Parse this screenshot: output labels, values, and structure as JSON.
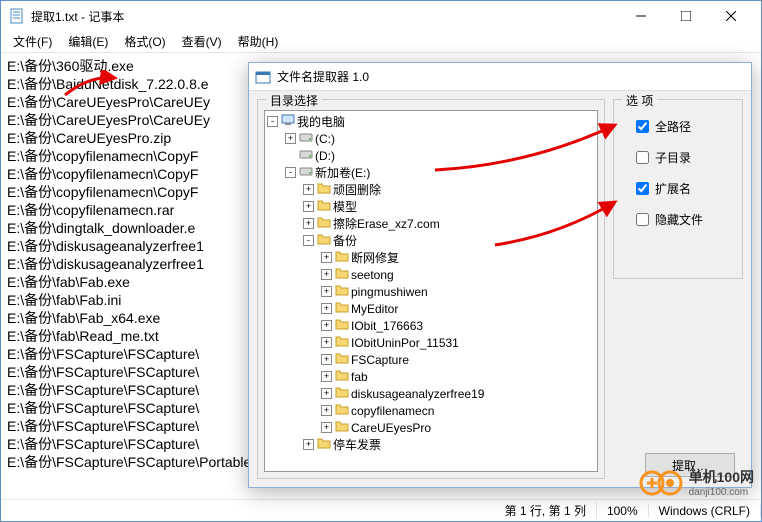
{
  "window": {
    "title": "提取1.txt - 记事本"
  },
  "menu": {
    "file": "文件(F)",
    "edit": "编辑(E)",
    "format": "格式(O)",
    "view": "查看(V)",
    "help": "帮助(H)"
  },
  "lines": [
    "E:\\备份\\360驱动.exe",
    "E:\\备份\\BaiduNetdisk_7.22.0.8.e",
    "E:\\备份\\CareUEyesPro\\CareUEy",
    "E:\\备份\\CareUEyesPro\\CareUEy",
    "E:\\备份\\CareUEyesPro.zip",
    "E:\\备份\\copyfilenamecn\\CopyF",
    "E:\\备份\\copyfilenamecn\\CopyF",
    "E:\\备份\\copyfilenamecn\\CopyF",
    "E:\\备份\\copyfilenamecn.rar",
    "E:\\备份\\dingtalk_downloader.e",
    "E:\\备份\\diskusageanalyzerfree1",
    "E:\\备份\\diskusageanalyzerfree1",
    "E:\\备份\\fab\\Fab.exe",
    "E:\\备份\\fab\\Fab.ini",
    "E:\\备份\\fab\\Fab_x64.exe",
    "E:\\备份\\fab\\Read_me.txt",
    "E:\\备份\\FSCapture\\FSCapture\\",
    "E:\\备份\\FSCapture\\FSCapture\\",
    "E:\\备份\\FSCapture\\FSCapture\\",
    "E:\\备份\\FSCapture\\FSCapture\\",
    "E:\\备份\\FSCapture\\FSCapture\\",
    "E:\\备份\\FSCapture\\FSCapture\\",
    "E:\\备份\\FSCapture\\FSCapture\\Portable.db"
  ],
  "status": {
    "pos": "第 1 行, 第 1 列",
    "zoom": "100%",
    "eol": "Windows (CRLF)"
  },
  "dialog": {
    "title": "文件名提取器 1.0",
    "tree_group": "目录选择",
    "options_group": "选 项",
    "opt_fullpath": "全路径",
    "opt_subdir": "子目录",
    "opt_ext": "扩展名",
    "opt_hidden": "隐藏文件",
    "extract_btn": "提取…",
    "tree": [
      {
        "depth": 0,
        "toggle": "-",
        "type": "computer",
        "label": "我的电脑"
      },
      {
        "depth": 1,
        "toggle": "+",
        "type": "drive",
        "label": "(C:)"
      },
      {
        "depth": 1,
        "toggle": "",
        "type": "drive",
        "label": "(D:)"
      },
      {
        "depth": 1,
        "toggle": "-",
        "type": "drive",
        "label": "新加卷(E:)"
      },
      {
        "depth": 2,
        "toggle": "+",
        "type": "folder",
        "label": "顽固删除"
      },
      {
        "depth": 2,
        "toggle": "+",
        "type": "folder",
        "label": "模型"
      },
      {
        "depth": 2,
        "toggle": "+",
        "type": "folder",
        "label": "擦除Erase_xz7.com"
      },
      {
        "depth": 2,
        "toggle": "-",
        "type": "folder",
        "label": "备份"
      },
      {
        "depth": 3,
        "toggle": "+",
        "type": "folder",
        "label": "断网修复"
      },
      {
        "depth": 3,
        "toggle": "+",
        "type": "folder",
        "label": "seetong"
      },
      {
        "depth": 3,
        "toggle": "+",
        "type": "folder",
        "label": "pingmushiwen"
      },
      {
        "depth": 3,
        "toggle": "+",
        "type": "folder",
        "label": "MyEditor"
      },
      {
        "depth": 3,
        "toggle": "+",
        "type": "folder",
        "label": "IObit_176663"
      },
      {
        "depth": 3,
        "toggle": "+",
        "type": "folder",
        "label": "IObitUninPor_11531"
      },
      {
        "depth": 3,
        "toggle": "+",
        "type": "folder",
        "label": "FSCapture"
      },
      {
        "depth": 3,
        "toggle": "+",
        "type": "folder",
        "label": "fab"
      },
      {
        "depth": 3,
        "toggle": "+",
        "type": "folder",
        "label": "diskusageanalyzerfree19"
      },
      {
        "depth": 3,
        "toggle": "+",
        "type": "folder",
        "label": "copyfilenamecn"
      },
      {
        "depth": 3,
        "toggle": "+",
        "type": "folder",
        "label": "CareUEyesPro"
      },
      {
        "depth": 2,
        "toggle": "+",
        "type": "folder",
        "label": "停车发票"
      }
    ],
    "checked": {
      "fullpath": true,
      "subdir": false,
      "ext": true,
      "hidden": false
    }
  },
  "watermark": {
    "brand": "单机100网",
    "url": "danji100.com"
  }
}
